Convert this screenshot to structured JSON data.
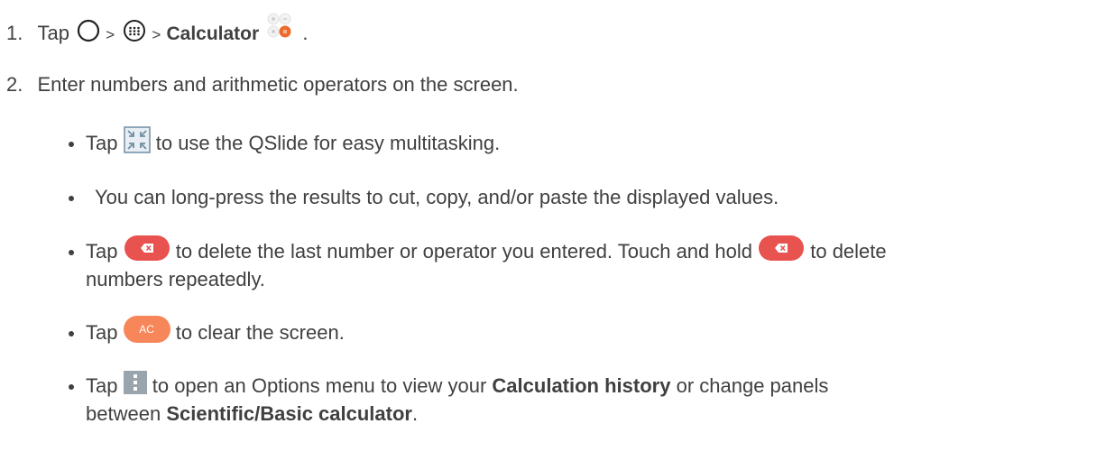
{
  "step1": {
    "number": "1.",
    "tap": "Tap",
    "sep1": ">",
    "sep2": ">",
    "calculator": "Calculator",
    "end": ".",
    "icons": [
      "home-circle-icon",
      "apps-grid-icon",
      "calculator-app-icon"
    ]
  },
  "step2": {
    "number": "2.",
    "text": "Enter numbers and arithmetic operators on the screen."
  },
  "bullets": {
    "qslide": {
      "pre": "Tap",
      "post": "to use the QSlide for easy multitasking.",
      "icon": "qslide-icon"
    },
    "longpress": {
      "text": "You can long-press the results to cut, copy, and/or paste the displayed values."
    },
    "delete": {
      "pre": "Tap",
      "mid": "to delete the last number or operator you entered. Touch and hold",
      "post": "to delete",
      "cont": "numbers repeatedly.",
      "icon": "backspace-icon"
    },
    "clear": {
      "pre": "Tap",
      "button_label": "AC",
      "post": "to clear the screen.",
      "icon": "ac-button-icon"
    },
    "options": {
      "pre": "Tap",
      "mid": "to open an Options menu to view your",
      "history": "Calculation history",
      "mid2": "or change panels",
      "cont_pre": "between",
      "mode": "Scientific/Basic calculator",
      "end": ".",
      "icon": "menu-dots-icon"
    }
  },
  "colors": {
    "text": "#404040",
    "delete_red": "#e8524f",
    "ac_orange": "#f7865a",
    "menu_gray": "#9aa4ad",
    "qslide_blue": "#6f8ea3"
  }
}
